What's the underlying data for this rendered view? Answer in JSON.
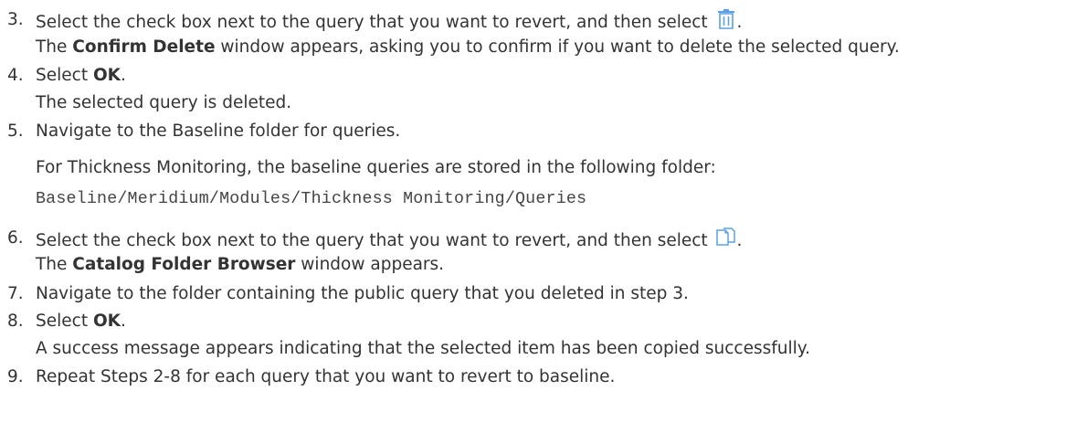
{
  "steps": [
    {
      "number": "3.",
      "text_before_icon": "Select the check box next to the query that you want to revert, and then select",
      "icon": "trash-icon",
      "text_after_icon": ".",
      "result_prefix": "The ",
      "result_bold": "Confirm Delete",
      "result_suffix": " window appears, asking you to confirm if you want to delete the selected query."
    },
    {
      "number": "4.",
      "prefix": "Select ",
      "bold": "OK",
      "suffix": ".",
      "result": "The selected query is deleted."
    },
    {
      "number": "5.",
      "text": "Navigate to the Baseline folder for queries.",
      "note": "For Thickness Monitoring, the baseline queries are stored in the following folder:",
      "code": "Baseline/Meridium/Modules/Thickness Monitoring/Queries"
    },
    {
      "number": "6.",
      "text_before_icon": "Select the check box next to the query that you want to revert, and then select",
      "icon": "copy-icon",
      "text_after_icon": ".",
      "result_prefix": "The ",
      "result_bold": "Catalog Folder Browser",
      "result_suffix": " window appears."
    },
    {
      "number": "7.",
      "text": "Navigate to the folder containing the public query that you deleted in step 3."
    },
    {
      "number": "8.",
      "prefix": "Select ",
      "bold": "OK",
      "suffix": ".",
      "result": "A success message appears indicating that the selected item has been copied successfully."
    },
    {
      "number": "9.",
      "text": "Repeat Steps 2-8 for each query that you want to revert to baseline."
    }
  ],
  "colors": {
    "text": "#333333",
    "icon": "#4a90d9"
  }
}
